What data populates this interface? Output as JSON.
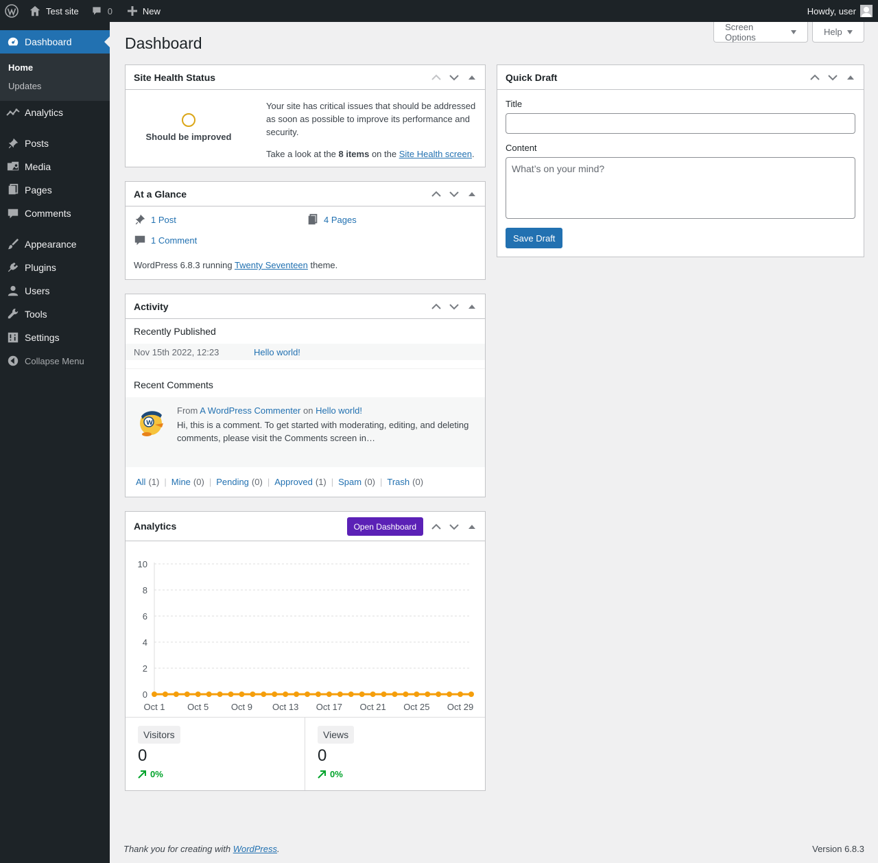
{
  "adminbar": {
    "site_name": "Test site",
    "comment_count": "0",
    "new_label": "New",
    "howdy": "Howdy, user"
  },
  "sidebar": {
    "dashboard": "Dashboard",
    "home": "Home",
    "updates": "Updates",
    "analytics": "Analytics",
    "posts": "Posts",
    "media": "Media",
    "pages": "Pages",
    "comments": "Comments",
    "appearance": "Appearance",
    "plugins": "Plugins",
    "users": "Users",
    "tools": "Tools",
    "settings": "Settings",
    "collapse": "Collapse Menu"
  },
  "page": {
    "title": "Dashboard",
    "screen_options": "Screen Options",
    "help": "Help"
  },
  "site_health": {
    "title": "Site Health Status",
    "status": "Should be improved",
    "message": "Your site has critical issues that should be addressed as soon as possible to improve its performance and security.",
    "take_look": "Take a look at the ",
    "items": "8 items",
    "on_the": " on the ",
    "link": "Site Health screen",
    "period": "."
  },
  "glance": {
    "title": "At a Glance",
    "posts": "1 Post",
    "pages": "4 Pages",
    "comments": "1 Comment",
    "footer_pre": "WordPress 6.8.3 running ",
    "theme": "Twenty Seventeen",
    "footer_post": " theme."
  },
  "activity": {
    "title": "Activity",
    "recently_published": "Recently Published",
    "post_date": "Nov 15th 2022, 12:23",
    "post_title": "Hello world!",
    "recent_comments": "Recent Comments",
    "from": "From ",
    "author": "A WordPress Commenter",
    "on": " on ",
    "comment_post": "Hello world!",
    "comment_text": "Hi, this is a comment. To get started with moderating, editing, and deleting comments, please visit the Comments screen in…",
    "filters": [
      {
        "label": "All",
        "count": "(1)"
      },
      {
        "label": "Mine",
        "count": "(0)"
      },
      {
        "label": "Pending",
        "count": "(0)"
      },
      {
        "label": "Approved",
        "count": "(1)"
      },
      {
        "label": "Spam",
        "count": "(0)"
      },
      {
        "label": "Trash",
        "count": "(0)"
      }
    ]
  },
  "analytics": {
    "title": "Analytics",
    "open_dashboard": "Open Dashboard",
    "visitors_label": "Visitors",
    "visitors_value": "0",
    "visitors_pct": "0%",
    "views_label": "Views",
    "views_value": "0",
    "views_pct": "0%"
  },
  "quick_draft": {
    "title": "Quick Draft",
    "title_label": "Title",
    "title_value": "",
    "content_label": "Content",
    "content_placeholder": "What’s on your mind?",
    "save": "Save Draft"
  },
  "footer": {
    "thanks_pre": "Thank you for creating with ",
    "wp_link": "WordPress",
    "thanks_post": ".",
    "version": "Version 6.8.3"
  },
  "chart_data": {
    "type": "line",
    "x": [
      "Oct 1",
      "Oct 2",
      "Oct 3",
      "Oct 4",
      "Oct 5",
      "Oct 6",
      "Oct 7",
      "Oct 8",
      "Oct 9",
      "Oct 10",
      "Oct 11",
      "Oct 12",
      "Oct 13",
      "Oct 14",
      "Oct 15",
      "Oct 16",
      "Oct 17",
      "Oct 18",
      "Oct 19",
      "Oct 20",
      "Oct 21",
      "Oct 22",
      "Oct 23",
      "Oct 24",
      "Oct 25",
      "Oct 26",
      "Oct 27",
      "Oct 28",
      "Oct 29",
      "Oct 30"
    ],
    "x_tick_labels": [
      "Oct 1",
      "Oct 5",
      "Oct 9",
      "Oct 13",
      "Oct 17",
      "Oct 21",
      "Oct 25",
      "Oct 29"
    ],
    "series": [
      {
        "values": [
          0,
          0,
          0,
          0,
          0,
          0,
          0,
          0,
          0,
          0,
          0,
          0,
          0,
          0,
          0,
          0,
          0,
          0,
          0,
          0,
          0,
          0,
          0,
          0,
          0,
          0,
          0,
          0,
          0,
          0
        ],
        "color": "#f59e0b"
      }
    ],
    "y_ticks": [
      0,
      2,
      4,
      6,
      8,
      10
    ],
    "ylim": [
      0,
      10
    ],
    "grid": true
  }
}
